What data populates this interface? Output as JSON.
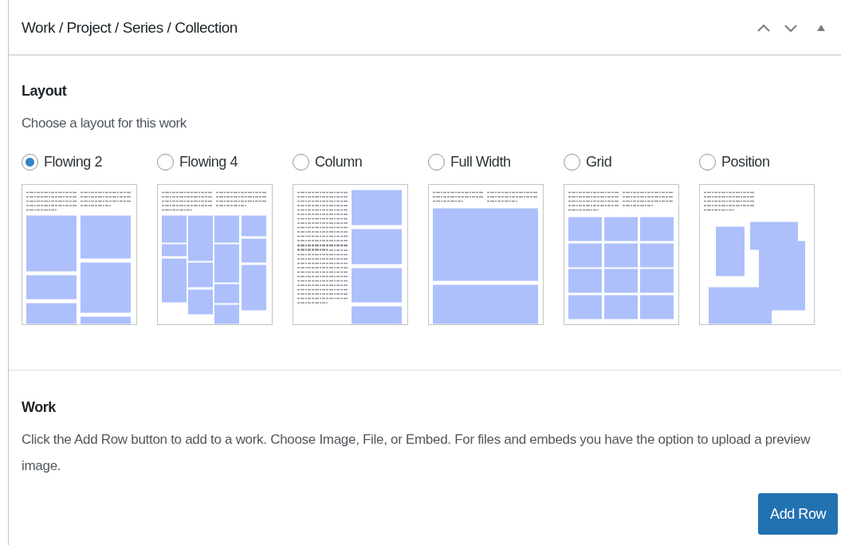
{
  "panel": {
    "title": "Work / Project / Series / Collection"
  },
  "layout": {
    "heading": "Layout",
    "description": "Choose a layout for this work",
    "options": [
      {
        "label": "Flowing 2",
        "kind": "flowing2",
        "selected": true
      },
      {
        "label": "Flowing 4",
        "kind": "flowing4",
        "selected": false
      },
      {
        "label": "Column",
        "kind": "column",
        "selected": false
      },
      {
        "label": "Full Width",
        "kind": "fullwidth",
        "selected": false
      },
      {
        "label": "Grid",
        "kind": "grid",
        "selected": false
      },
      {
        "label": "Position",
        "kind": "position",
        "selected": false
      }
    ]
  },
  "work": {
    "heading": "Work",
    "description": "Click the Add Row button to add to a work. Choose Image, File, or Embed. For files and embeds you have the option to upload a preview image.",
    "button": "Add Row"
  }
}
